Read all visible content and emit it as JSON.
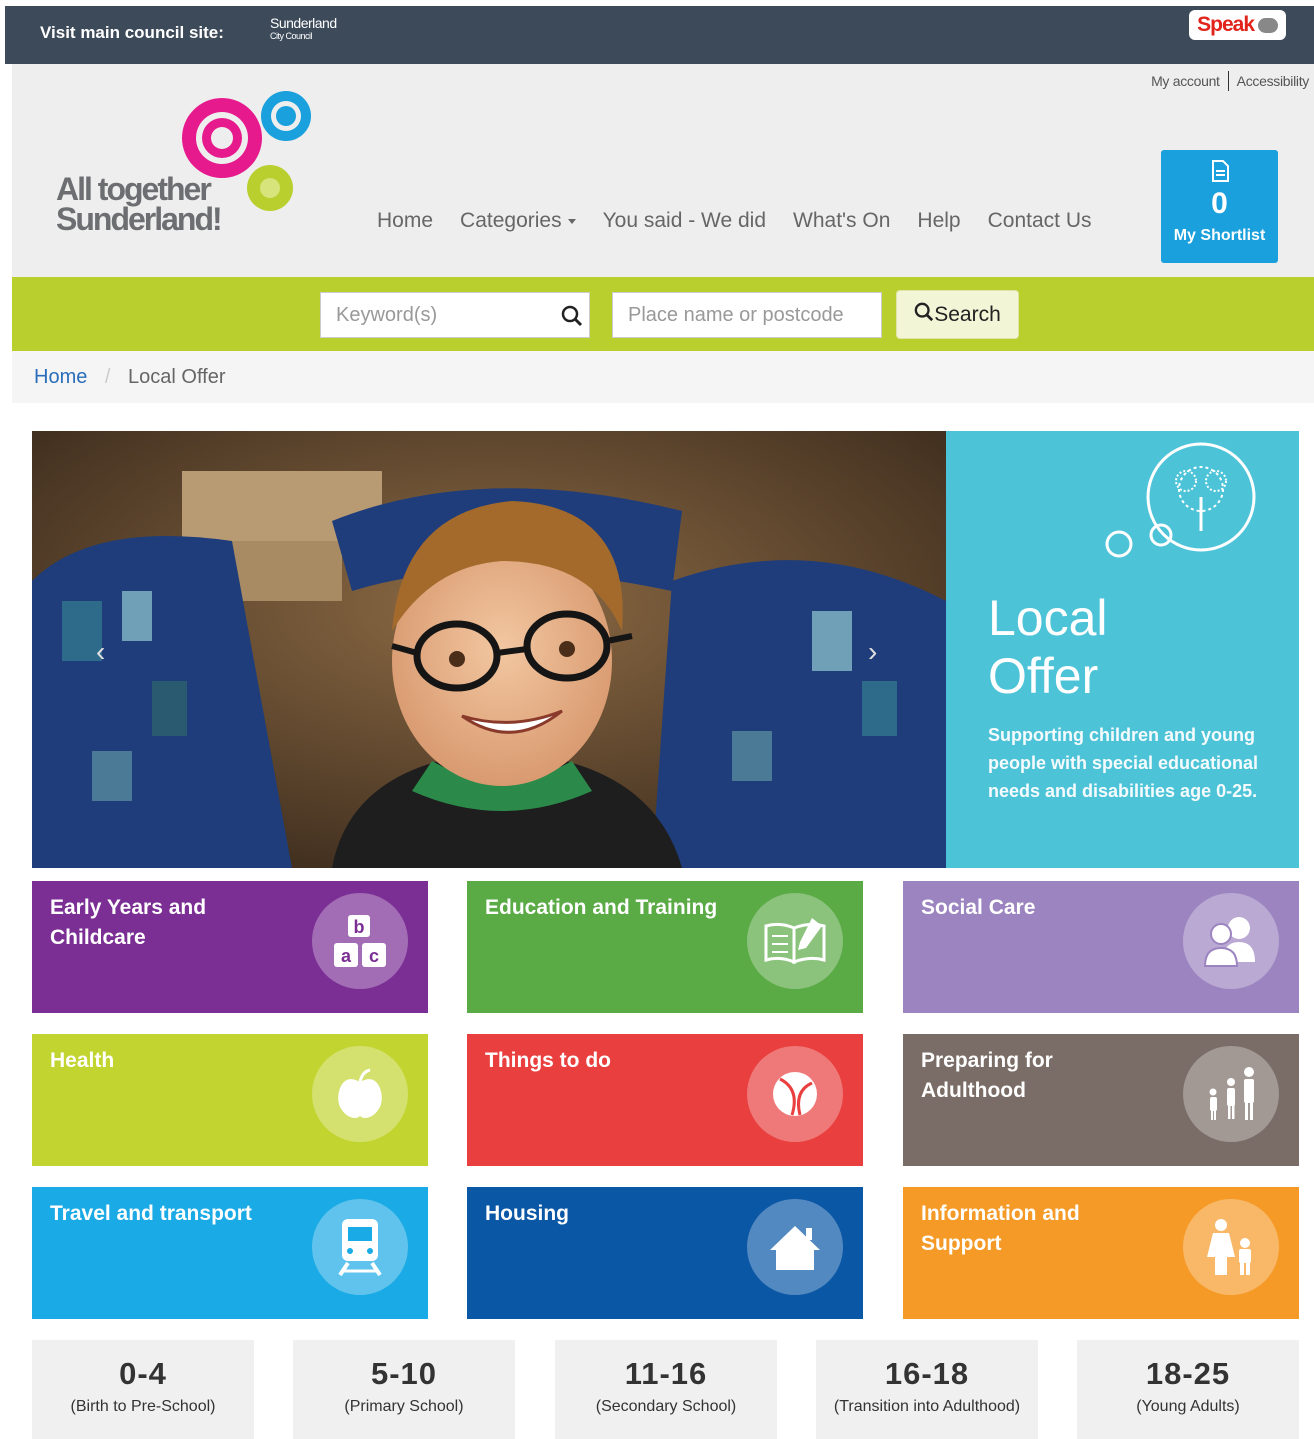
{
  "council_bar": {
    "label": "Visit main council site:",
    "council_logo_line1": "Sunderland",
    "council_logo_line2": "City Council",
    "speak_label": "Speak"
  },
  "header": {
    "util_links": [
      "My account",
      "Accessibility"
    ],
    "logo_line1": "All together",
    "logo_line2": "Sunderland!",
    "nav": [
      "Home",
      "Categories",
      "You said - We did",
      "What's On",
      "Help",
      "Contact Us"
    ],
    "shortlist": {
      "count": "0",
      "label": "My Shortlist"
    }
  },
  "search": {
    "keyword_placeholder": "Keyword(s)",
    "location_placeholder": "Place name or postcode",
    "button_label": "Search"
  },
  "breadcrumb": {
    "home": "Home",
    "separator": "/",
    "current": "Local Offer"
  },
  "hero": {
    "prev": "‹",
    "next": "›",
    "title_line1": "Local",
    "title_line2": "Offer",
    "description": "Supporting children and young people with special educational needs and disabilities age 0-25."
  },
  "tiles": [
    {
      "label": "Early Years and Childcare",
      "color": "#7b2f95",
      "icon": "abc-blocks-icon"
    },
    {
      "label": "Education and Training",
      "color": "#5aaa45",
      "icon": "book-icon"
    },
    {
      "label": "Social Care",
      "color": "#9c84c0",
      "icon": "people-icon"
    },
    {
      "label": "Health",
      "color": "#c2d430",
      "icon": "apple-icon"
    },
    {
      "label": "Things to do",
      "color": "#e93f3e",
      "icon": "ball-icon"
    },
    {
      "label": "Preparing for Adulthood",
      "color": "#7a6d67",
      "icon": "family-icon"
    },
    {
      "label": "Travel and transport",
      "color": "#1aaae5",
      "icon": "train-icon"
    },
    {
      "label": "Housing",
      "color": "#0a57a6",
      "icon": "house-icon"
    },
    {
      "label": "Information and Support",
      "color": "#f59a26",
      "icon": "parent-child-icon"
    }
  ],
  "ages": [
    {
      "range": "0-4",
      "desc": "(Birth to Pre-School)"
    },
    {
      "range": "5-10",
      "desc": "(Primary School)"
    },
    {
      "range": "11-16",
      "desc": "(Secondary School)"
    },
    {
      "range": "16-18",
      "desc": "(Transition into Adulthood)"
    },
    {
      "range": "18-25",
      "desc": "(Young Adults)"
    }
  ]
}
